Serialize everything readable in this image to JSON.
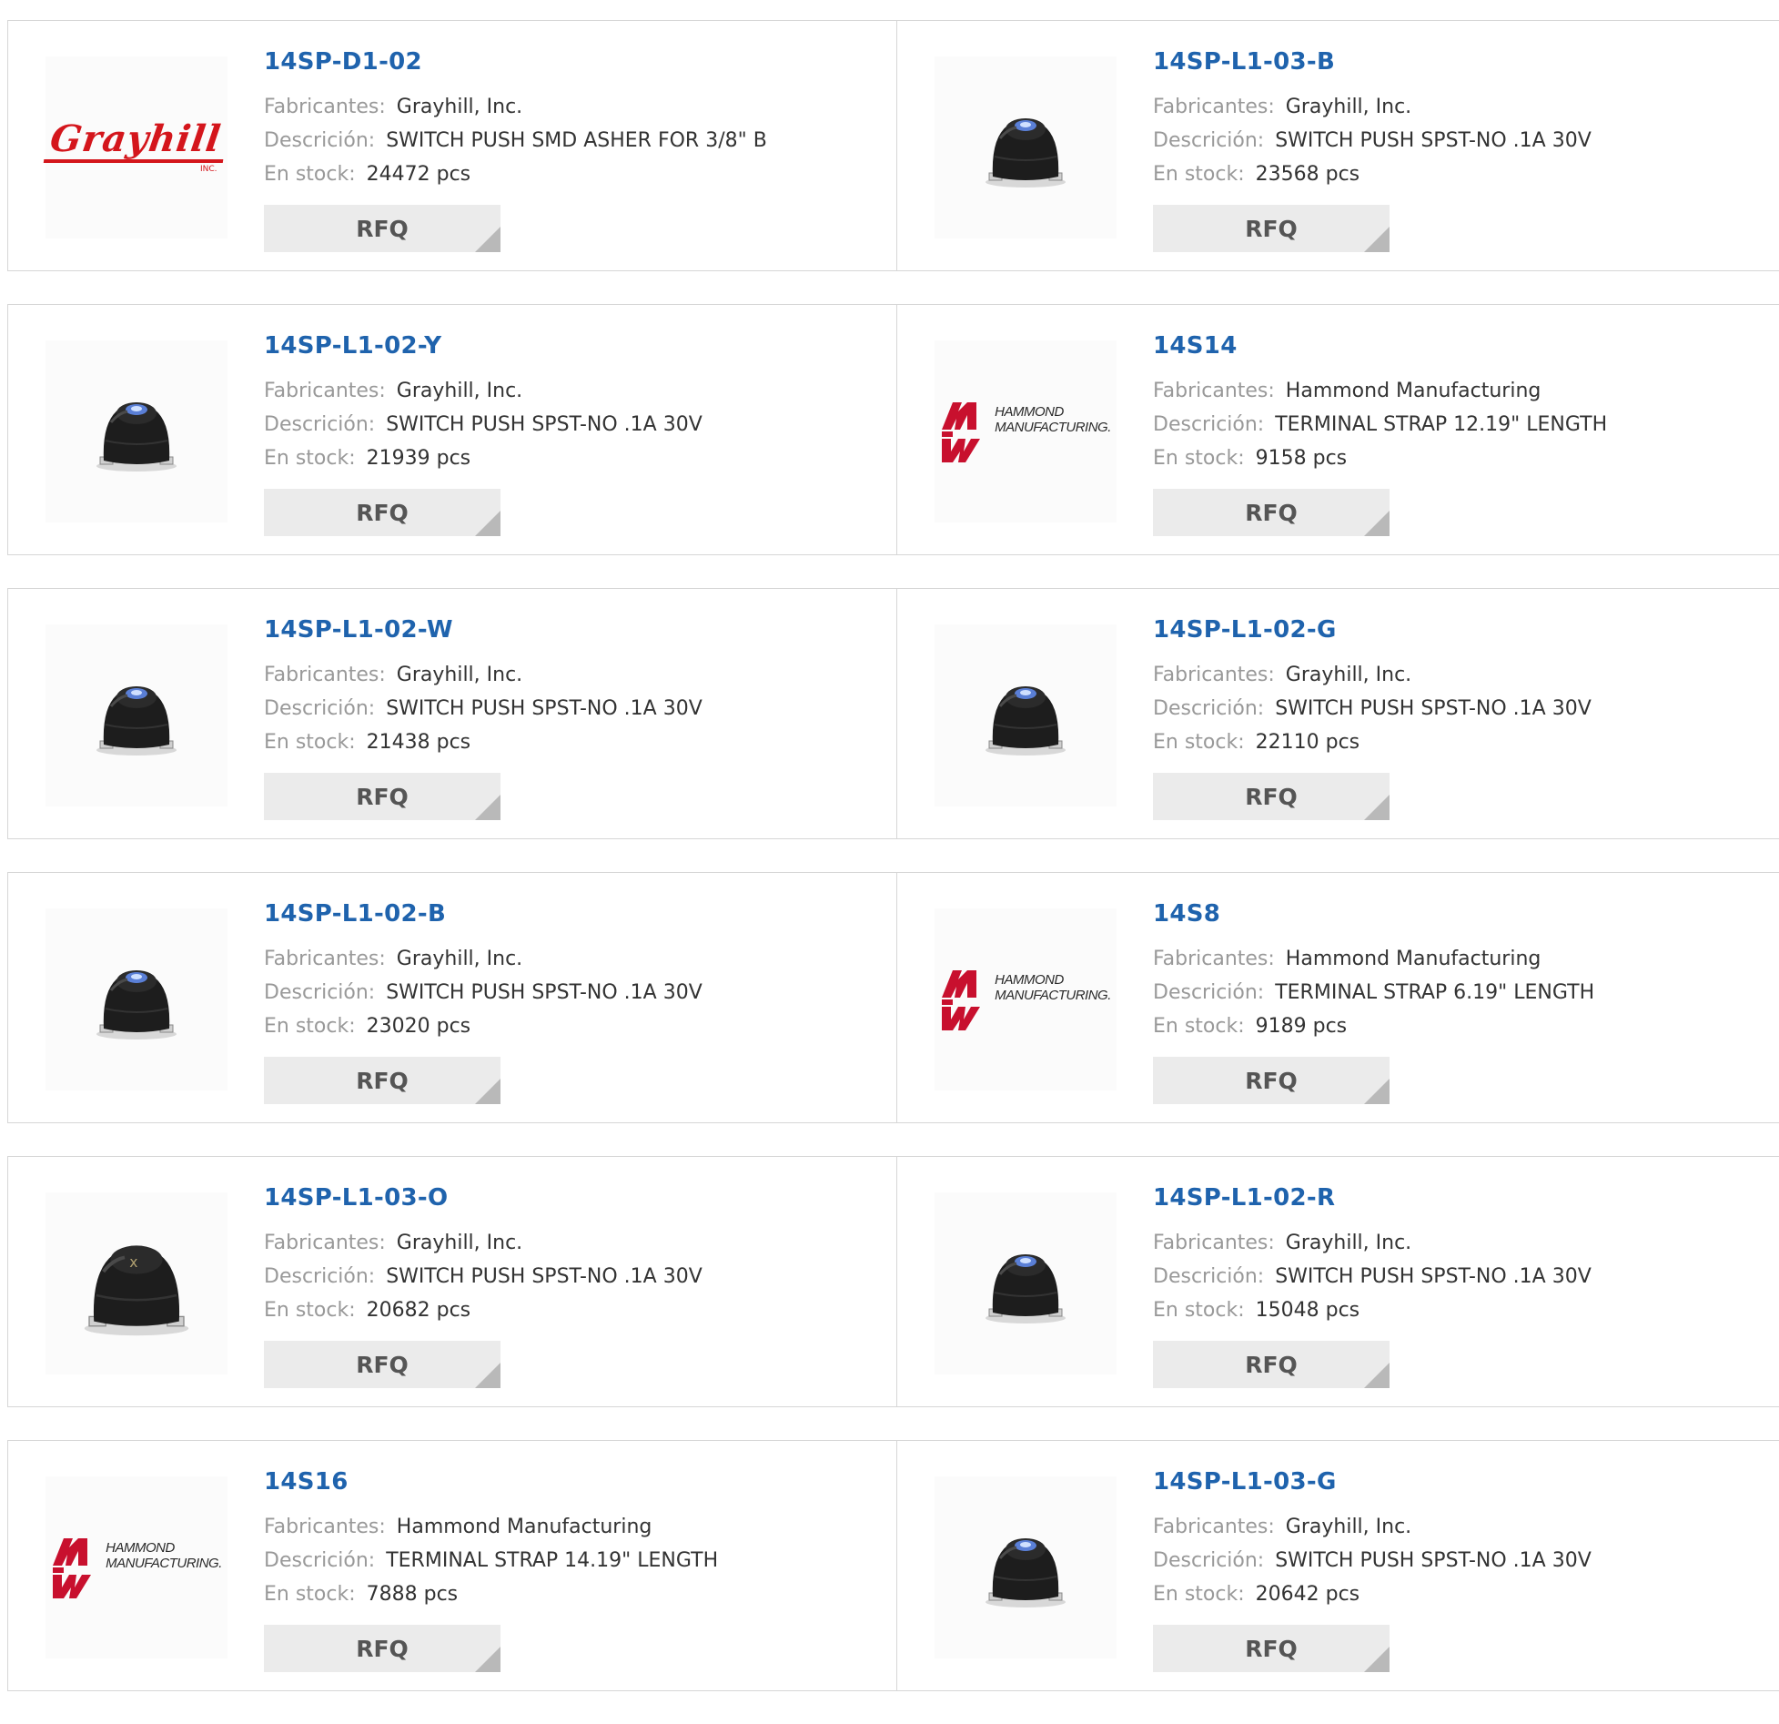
{
  "labels": {
    "manufacturer": "Fabricantes:",
    "description": "Descrición:",
    "stock": "En stock:",
    "rfq": "RFQ"
  },
  "logos": {
    "grayhill": "Grayhill",
    "grayhill_inc": "INC.",
    "hammond_line1": "HAMMOND",
    "hammond_line2": "MANUFACTURING."
  },
  "colors": {
    "part_link": "#1f63ad",
    "label": "#999999",
    "rfq_bg": "#ebebeb",
    "grayhill_red": "#d4161c",
    "hammond_red": "#c8102e"
  },
  "products": [
    {
      "part": "14SP-D1-02",
      "image": "grayhill-logo",
      "manufacturer": "Grayhill, Inc.",
      "description": "SWITCH PUSH SMD ASHER FOR 3/8\" B",
      "stock": "24472 pcs"
    },
    {
      "part": "14SP-L1-03-B",
      "image": "push-switch-photo",
      "manufacturer": "Grayhill, Inc.",
      "description": "SWITCH PUSH SPST-NO .1A 30V",
      "stock": "23568 pcs"
    },
    {
      "part": "14SP-L1-02-Y",
      "image": "push-switch-photo",
      "manufacturer": "Grayhill, Inc.",
      "description": "SWITCH PUSH SPST-NO .1A 30V",
      "stock": "21939 pcs"
    },
    {
      "part": "14S14",
      "image": "hammond-logo",
      "manufacturer": "Hammond Manufacturing",
      "description": "TERMINAL STRAP 12.19\" LENGTH",
      "stock": "9158 pcs"
    },
    {
      "part": "14SP-L1-02-W",
      "image": "push-switch-photo",
      "manufacturer": "Grayhill, Inc.",
      "description": "SWITCH PUSH SPST-NO .1A 30V",
      "stock": "21438 pcs"
    },
    {
      "part": "14SP-L1-02-G",
      "image": "push-switch-photo",
      "manufacturer": "Grayhill, Inc.",
      "description": "SWITCH PUSH SPST-NO .1A 30V",
      "stock": "22110 pcs"
    },
    {
      "part": "14SP-L1-02-B",
      "image": "push-switch-photo",
      "manufacturer": "Grayhill, Inc.",
      "description": "SWITCH PUSH SPST-NO .1A 30V",
      "stock": "23020 pcs"
    },
    {
      "part": "14S8",
      "image": "hammond-logo",
      "manufacturer": "Hammond Manufacturing",
      "description": "TERMINAL STRAP 6.19\" LENGTH",
      "stock": "9189 pcs"
    },
    {
      "part": "14SP-L1-03-O",
      "image": "push-switch-photo-large",
      "manufacturer": "Grayhill, Inc.",
      "description": "SWITCH PUSH SPST-NO .1A 30V",
      "stock": "20682 pcs"
    },
    {
      "part": "14SP-L1-02-R",
      "image": "push-switch-photo",
      "manufacturer": "Grayhill, Inc.",
      "description": "SWITCH PUSH SPST-NO .1A 30V",
      "stock": "15048 pcs"
    },
    {
      "part": "14S16",
      "image": "hammond-logo",
      "manufacturer": "Hammond Manufacturing",
      "description": "TERMINAL STRAP 14.19\" LENGTH",
      "stock": "7888 pcs"
    },
    {
      "part": "14SP-L1-03-G",
      "image": "push-switch-photo",
      "manufacturer": "Grayhill, Inc.",
      "description": "SWITCH PUSH SPST-NO .1A 30V",
      "stock": "20642 pcs"
    }
  ]
}
